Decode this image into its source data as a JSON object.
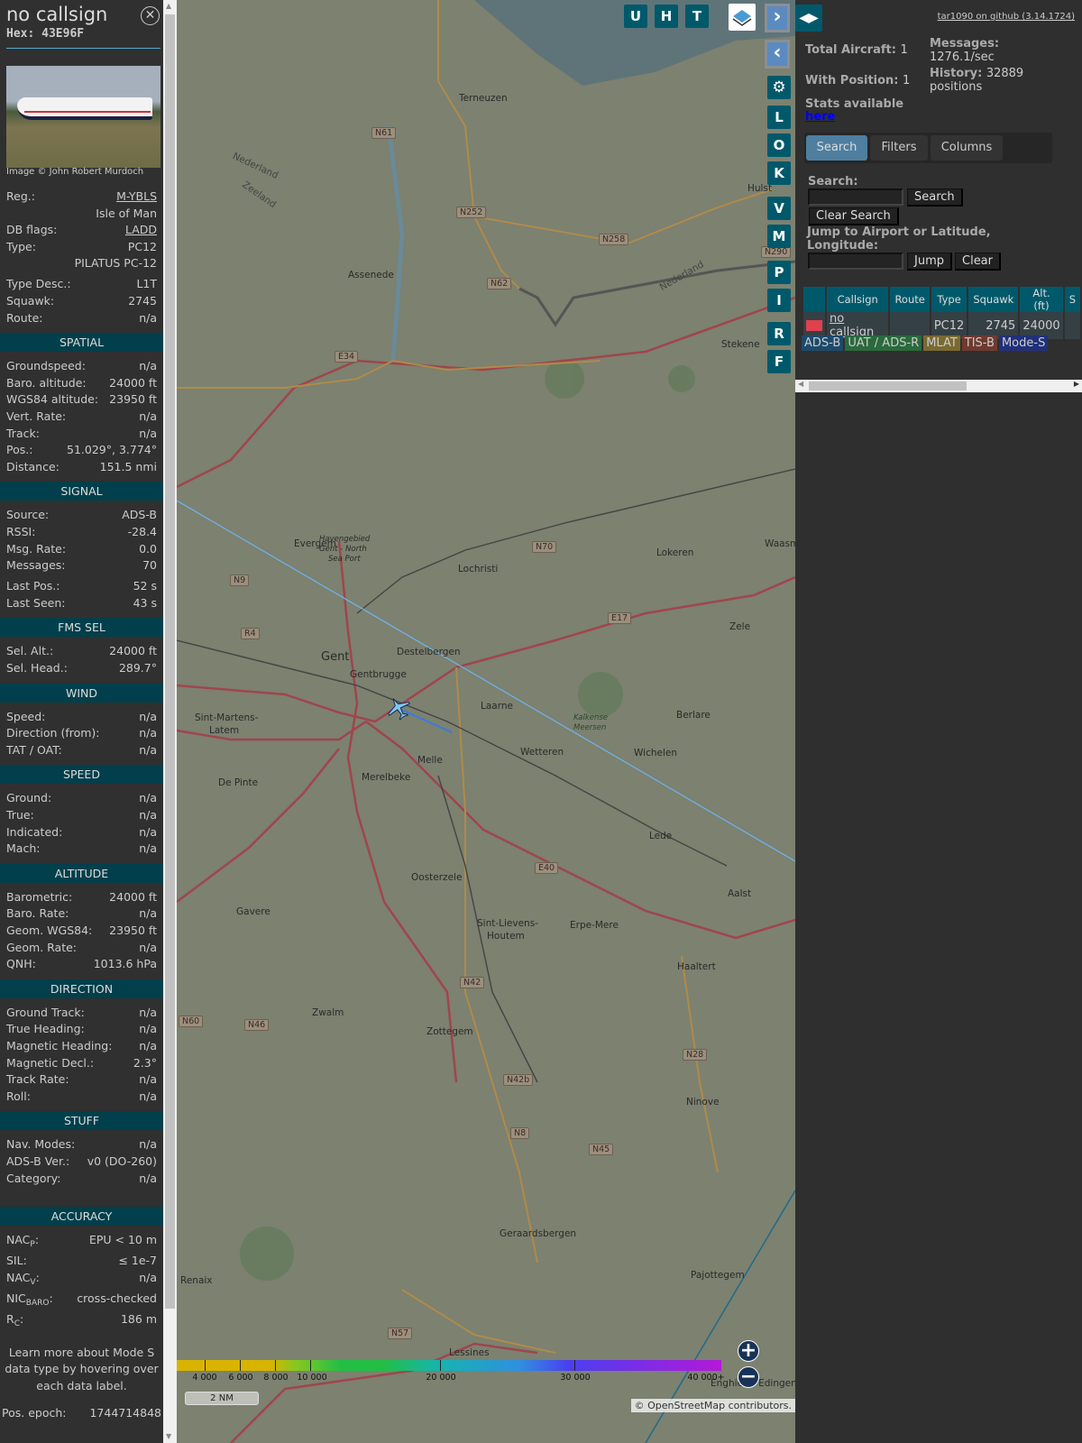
{
  "sidebar": {
    "callsign": "no callsign",
    "hex_label": "Hex:",
    "hex": "43E96F",
    "close_icon": "close-circle-icon",
    "image_credit": "Image © John Robert Murdoch",
    "top_rows": [
      {
        "label": "Reg.:",
        "value": "M-YBLS"
      },
      {
        "label": "",
        "value": "Isle of Man"
      },
      {
        "label": "DB flags:",
        "value": "LADD"
      },
      {
        "label": "Type:",
        "value": "PC12"
      },
      {
        "label": "",
        "value": "PILATUS PC-12"
      },
      {
        "label": "Type Desc.:",
        "value": "L1T"
      },
      {
        "label": "Squawk:",
        "value": "2745"
      },
      {
        "label": "Route:",
        "value": "n/a"
      }
    ],
    "sections": [
      {
        "title": "SPATIAL",
        "rows": [
          {
            "label": "Groundspeed:",
            "value": "n/a"
          },
          {
            "label": "Baro. altitude:",
            "value": "24000 ft"
          },
          {
            "label": "WGS84 altitude:",
            "value": "23950 ft"
          },
          {
            "label": "Vert. Rate:",
            "value": "n/a"
          },
          {
            "label": "Track:",
            "value": "n/a"
          },
          {
            "label": "Pos.:",
            "value": "51.029°, 3.774°"
          },
          {
            "label": "Distance:",
            "value": "151.5 nmi"
          }
        ]
      },
      {
        "title": "SIGNAL",
        "rows": [
          {
            "label": "Source:",
            "value": "ADS-B"
          },
          {
            "label": "RSSI:",
            "value": "-28.4"
          },
          {
            "label": "Msg. Rate:",
            "value": "0.0"
          },
          {
            "label": "Messages:",
            "value": "70"
          },
          {
            "label": "Last Pos.:",
            "value": "52 s"
          },
          {
            "label": "Last Seen:",
            "value": "43 s"
          }
        ]
      },
      {
        "title": "FMS SEL",
        "rows": [
          {
            "label": "Sel. Alt.:",
            "value": "24000 ft"
          },
          {
            "label": "Sel. Head.:",
            "value": "289.7°"
          }
        ]
      },
      {
        "title": "WIND",
        "rows": [
          {
            "label": "Speed:",
            "value": "n/a"
          },
          {
            "label": "Direction (from):",
            "value": "n/a"
          },
          {
            "label": "TAT / OAT:",
            "value": "n/a"
          }
        ]
      },
      {
        "title": "SPEED",
        "rows": [
          {
            "label": "Ground:",
            "value": "n/a"
          },
          {
            "label": "True:",
            "value": "n/a"
          },
          {
            "label": "Indicated:",
            "value": "n/a"
          },
          {
            "label": "Mach:",
            "value": "n/a"
          }
        ]
      },
      {
        "title": "ALTITUDE",
        "rows": [
          {
            "label": "Barometric:",
            "value": "24000 ft"
          },
          {
            "label": "Baro. Rate:",
            "value": "n/a"
          },
          {
            "label": "Geom. WGS84:",
            "value": "23950 ft"
          },
          {
            "label": "Geom. Rate:",
            "value": "n/a"
          },
          {
            "label": "QNH:",
            "value": "1013.6 hPa"
          }
        ]
      },
      {
        "title": "DIRECTION",
        "rows": [
          {
            "label": "Ground Track:",
            "value": "n/a"
          },
          {
            "label": "True Heading:",
            "value": "n/a"
          },
          {
            "label": "Magnetic Heading:",
            "value": "n/a"
          },
          {
            "label": "Magnetic Decl.:",
            "value": "2.3°"
          },
          {
            "label": "Track Rate:",
            "value": "n/a"
          },
          {
            "label": "Roll:",
            "value": "n/a"
          }
        ]
      },
      {
        "title": "STUFF",
        "rows": [
          {
            "label": "Nav. Modes:",
            "value": "n/a"
          },
          {
            "label": "ADS-B Ver.:",
            "value": "v0 (DO-260)"
          },
          {
            "label": "Category:",
            "value": "n/a"
          }
        ]
      }
    ],
    "accuracy": {
      "title": "ACCURACY",
      "nacp_base": "NAC",
      "nacp_sub": "P",
      "nacp": "EPU < 10 m",
      "sil_label": "SIL:",
      "sil": "≤ 1e-7",
      "nacv_base": "NAC",
      "nacv_sub": "V",
      "nacv": "n/a",
      "nic_base": "NIC",
      "nic_sub": "BARO",
      "nic": "cross-checked",
      "rc_base": "R",
      "rc_sub": "C",
      "rc": "186 m"
    },
    "note": "Learn more about Mode S data type by hovering over each data label.",
    "pos_epoch_label": "Pos. epoch:",
    "pos_epoch": "1744714848"
  },
  "map": {
    "buttons_top": [
      "U",
      "H",
      "T"
    ],
    "buttons_side": [
      "L",
      "O",
      "K",
      "V",
      "M",
      "P",
      "I",
      "R",
      "F"
    ],
    "layers_icon": "layers-icon",
    "settings_icon": "gear-icon",
    "places": {
      "terneuzen": "Terneuzen",
      "hulst": "Hulst",
      "assenede": "Assenede",
      "stekene": "Stekene",
      "evergem": "Evergem",
      "lochristi": "Lochristi",
      "lokeren": "Lokeren",
      "waasm": "Waasm",
      "gent": "Gent",
      "destelbergen": "Destelbergen",
      "gentbrugge": "Gentbrugge",
      "zele": "Zele",
      "sintmartens": "Sint-Martens-",
      "latem": "Latem",
      "laarne": "Laarne",
      "berlare": "Berlare",
      "kalkense": "Kalkense",
      "meersen": "Meersen",
      "wetteren": "Wetteren",
      "wichelen": "Wichelen",
      "melle": "Melle",
      "merelbeke": "Merelbeke",
      "depinte": "De Pinte",
      "lede": "Lede",
      "aalst": "Aalst",
      "oosterzele": "Oosterzele",
      "gavere": "Gavere",
      "sintlievens": "Sint-Lievens-",
      "houtem": "Houtem",
      "erpemere": "Erpe-Mere",
      "haaltert": "Haaltert",
      "zwalm": "Zwalm",
      "zottegem": "Zottegem",
      "ninove": "Ninove",
      "geraardsbergen": "Geraardsbergen",
      "renaix": "Renaix",
      "pajottegem": "Pajottegem",
      "lessines": "Lessines",
      "enghien": "Enghien - Edingen",
      "nederland1": "Nederland",
      "nederland2": "Nederland",
      "zeeland": "Zeeland",
      "havengebied": "Havengebied",
      "gentnorth": "Gent - North",
      "seaport": "Sea Port"
    },
    "roads": {
      "n61": "N61",
      "n252": "N252",
      "n258": "N258",
      "n290": "N290",
      "n62": "N62",
      "e34": "E34",
      "n70": "N70",
      "n9": "N9",
      "e17": "E17",
      "r4": "R4",
      "e40": "E40",
      "n42": "N42",
      "n60": "N60",
      "n46": "N46",
      "n28": "N28",
      "n42b": "N42b",
      "n8": "N8",
      "n45": "N45",
      "n57": "N57"
    },
    "legend": [
      "4 000",
      "6 000",
      "8 000",
      "10 000",
      "20 000",
      "30 000",
      "40 000+"
    ],
    "scale": "2 NM",
    "attribution": "© OpenStreetMap contributors."
  },
  "panel": {
    "github": "tar1090 on github (3.14.1724)",
    "total_label": "Total Aircraft:",
    "total": "1",
    "withpos_label": "With Position:",
    "withpos": "1",
    "messages_label": "Messages:",
    "messages": "1276.1/sec",
    "history_label": "History:",
    "history": "32889",
    "history_unit": "positions",
    "stats": "Stats available",
    "here": "here",
    "tabs": [
      "Search",
      "Filters",
      "Columns"
    ],
    "search_label": "Search:",
    "search_value": "",
    "search_btn": "Search",
    "clear_search_btn": "Clear Search",
    "jump_label": "Jump to Airport or Latitude, Longitude:",
    "jump_value": "",
    "jump_btn": "Jump",
    "clear_btn": "Clear",
    "table": {
      "headers": [
        "",
        "Callsign",
        "Route",
        "Type",
        "Squawk",
        "Alt. (ft)",
        "S"
      ],
      "rows": [
        {
          "callsign": "no callsign",
          "route": "",
          "type": "PC12",
          "squawk": "2745",
          "alt": "24000"
        }
      ]
    },
    "badges": [
      {
        "label": "ADS-B",
        "color": "#1d4a6a"
      },
      {
        "label": "UAT / ADS-R",
        "color": "#2a6a3c"
      },
      {
        "label": "MLAT",
        "color": "#7a6a30"
      },
      {
        "label": "TIS-B",
        "color": "#6e3a30"
      },
      {
        "label": "Mode-S",
        "color": "#22307a"
      }
    ]
  }
}
